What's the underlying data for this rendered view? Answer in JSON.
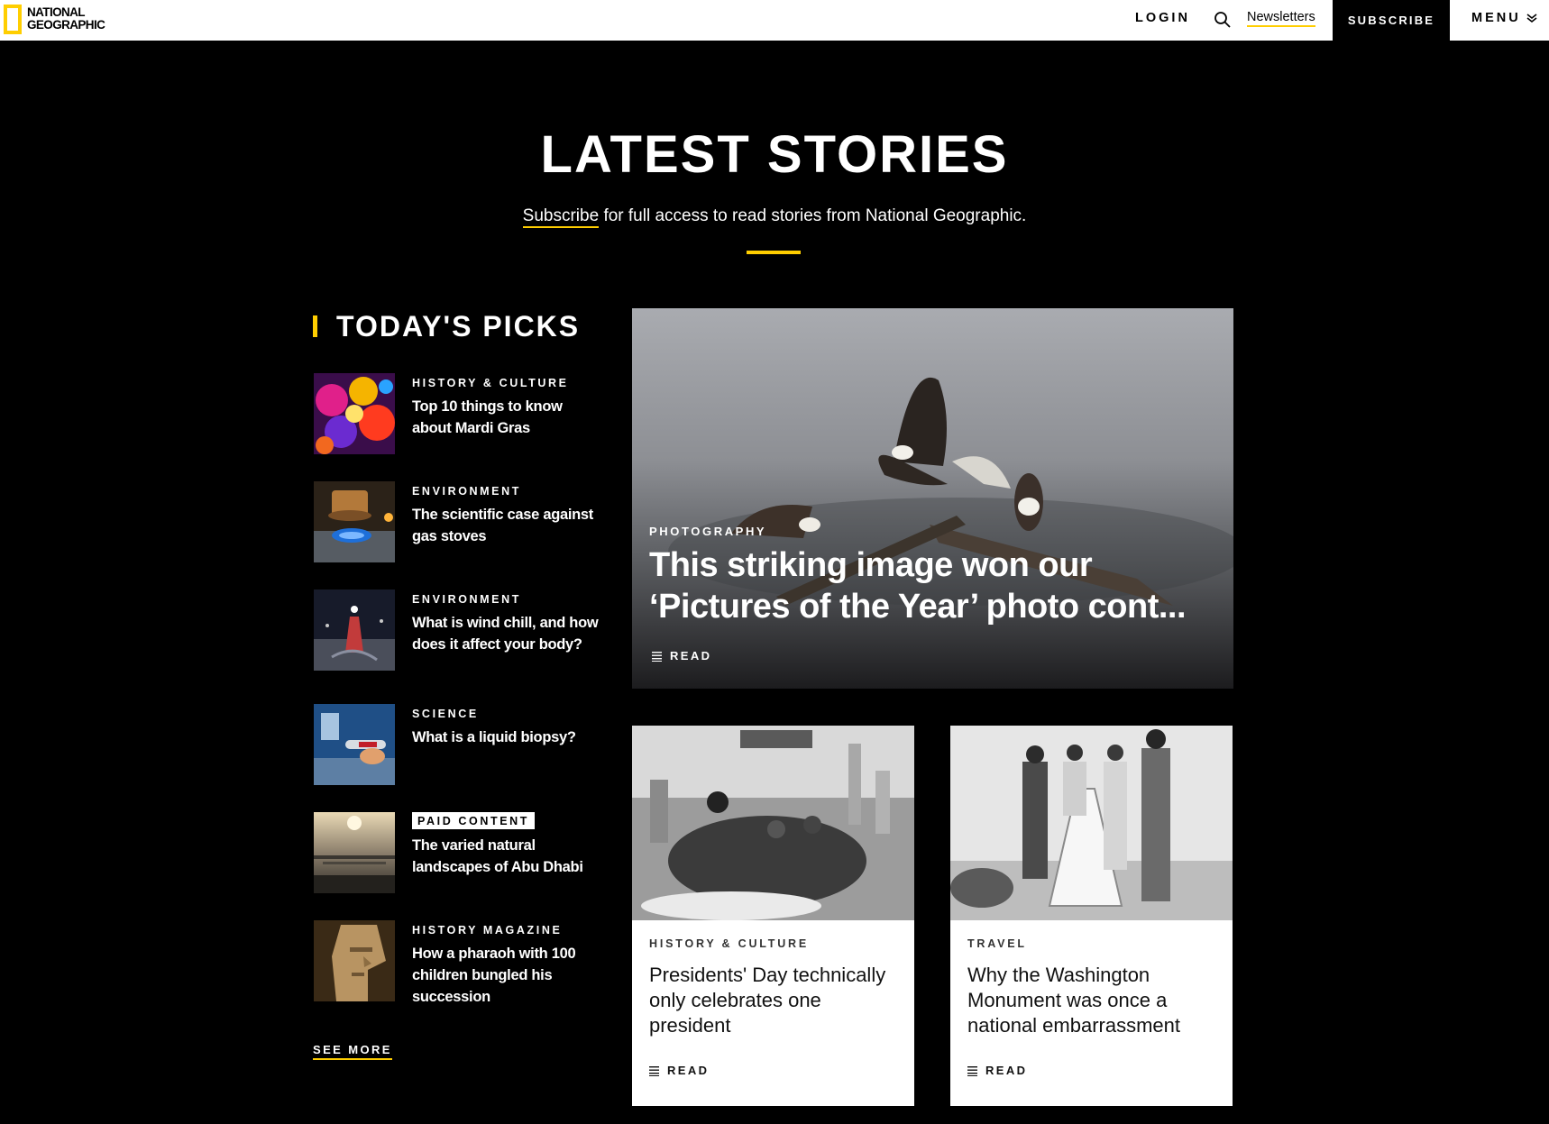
{
  "header": {
    "logo_line1": "NATIONAL",
    "logo_line2": "GEOGRAPHIC",
    "login": "LOGIN",
    "search_icon": "search-icon",
    "newsletters": "Newsletters",
    "subscribe": "SUBSCRIBE",
    "menu": "MENU",
    "brand_yellow": "#FFCE00"
  },
  "hero": {
    "title": "LATEST STORIES",
    "subscribe_link": "Subscribe",
    "subtitle_rest": " for full access to read stories from National Geographic."
  },
  "picks": {
    "title": "TODAY'S PICKS",
    "items": [
      {
        "category": "HISTORY & CULTURE",
        "title": "Top 10 things to know about Mardi Gras",
        "paid": false
      },
      {
        "category": "ENVIRONMENT",
        "title": "The scientific case against gas stoves",
        "paid": false
      },
      {
        "category": "ENVIRONMENT",
        "title": "What is wind chill, and how does it affect your body?",
        "paid": false
      },
      {
        "category": "SCIENCE",
        "title": "What is a liquid biopsy?",
        "paid": false
      },
      {
        "category": "PAID CONTENT",
        "title": "The varied natural landscapes of Abu Dhabi",
        "paid": true
      },
      {
        "category": "HISTORY MAGAZINE",
        "title": "How a pharaoh with 100 children bungled his succession",
        "paid": false
      }
    ],
    "see_more": "SEE MORE"
  },
  "feature": {
    "category": "PHOTOGRAPHY",
    "title": "This striking image won our ‘Pictures of the Year’ photo cont...",
    "read": "READ"
  },
  "cards": [
    {
      "category": "HISTORY & CULTURE",
      "title": "Presidents' Day technically only celebrates one president",
      "read": "READ"
    },
    {
      "category": "TRAVEL",
      "title": "Why the Washington Monument was once a national embarrassment",
      "read": "READ"
    }
  ]
}
